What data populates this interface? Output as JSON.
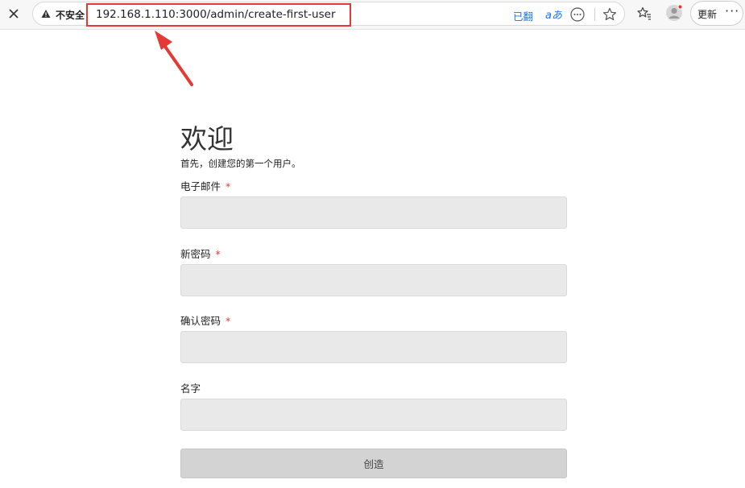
{
  "browser": {
    "security_label": "不安全",
    "url": "192.168.1.110:3000/admin/create-first-user",
    "translated_label": "已翻",
    "translate_icon_text": "aあ",
    "update_label": "更新",
    "menu_dots": "···"
  },
  "form": {
    "title": "欢迎",
    "subtitle": "首先，创建您的第一个用户。",
    "required_marker": "*",
    "fields": [
      {
        "label": "电子邮件",
        "required": true,
        "value": ""
      },
      {
        "label": "新密码",
        "required": true,
        "value": ""
      },
      {
        "label": "确认密码",
        "required": true,
        "value": ""
      },
      {
        "label": "名字",
        "required": false,
        "value": ""
      }
    ],
    "submit_label": "创造"
  },
  "colors": {
    "annotation": "#e53935",
    "link": "#1a73e8",
    "input_bg": "#e9e9e9",
    "button_bg": "#d3d3d3"
  },
  "icons": [
    "close-icon",
    "warning-icon",
    "translate-icon",
    "more-options-icon",
    "star-icon",
    "favorites-icon",
    "profile-avatar",
    "more-icon"
  ]
}
